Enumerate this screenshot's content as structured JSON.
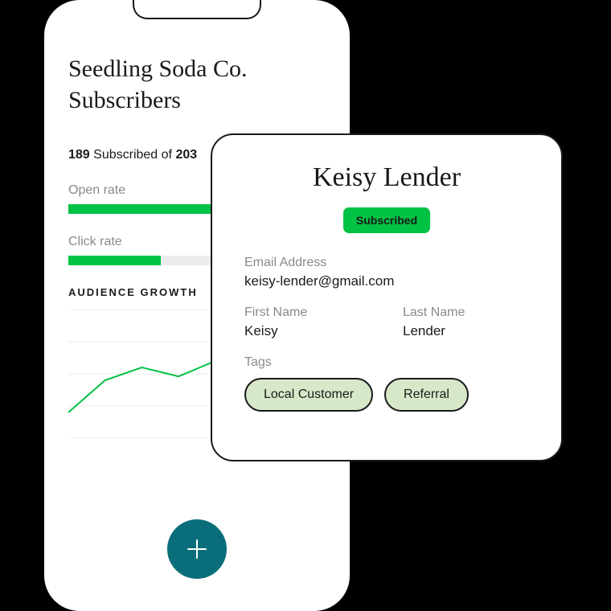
{
  "phone": {
    "title_line1": "Seedling Soda Co.",
    "title_line2": "Subscribers",
    "subscribed_count": "189",
    "subscribed_label": " Subscribed of ",
    "total_count": "203",
    "open_rate_label": "Open rate",
    "click_rate_label": "Click rate",
    "growth_header": "AUDIENCE GROWTH"
  },
  "metrics": {
    "open_rate_pct": 100,
    "click_rate_pct": 36
  },
  "card": {
    "name": "Keisy Lender",
    "badge": "Subscribed",
    "email_label": "Email Address",
    "email_value": "keisy-lender@gmail.com",
    "first_name_label": "First Name",
    "first_name_value": "Keisy",
    "last_name_label": "Last Name",
    "last_name_value": "Lender",
    "tags_label": "Tags",
    "tag1": "Local Customer",
    "tag2": "Referral"
  },
  "chart_data": {
    "type": "line",
    "title": "AUDIENCE GROWTH",
    "x": [
      0,
      1,
      2,
      3,
      4,
      5,
      6,
      7
    ],
    "y": [
      20,
      45,
      55,
      48,
      60,
      62,
      78,
      90
    ],
    "ylim": [
      0,
      100
    ],
    "gridlines": 4
  },
  "colors": {
    "accent_green": "#00c244",
    "fab_teal": "#0a6e7a",
    "tag_bg": "#d7e8c9",
    "grid": "#e8e8e8",
    "muted": "#8a8a8a"
  }
}
